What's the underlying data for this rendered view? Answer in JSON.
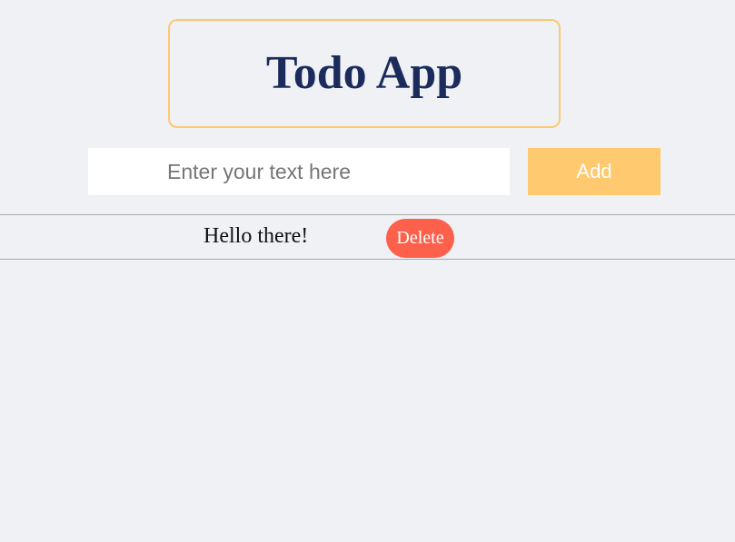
{
  "header": {
    "title": "Todo App"
  },
  "form": {
    "input_value": "",
    "input_placeholder": "Enter your text here",
    "add_label": "Add"
  },
  "todos": [
    {
      "text": "Hello there!",
      "delete_label": "Delete"
    }
  ],
  "colors": {
    "background": "#f0f1f5",
    "title_border": "#fcc872",
    "title_text": "#1b2c5c",
    "add_button": "#fec96f",
    "delete_button": "#fd604b"
  }
}
